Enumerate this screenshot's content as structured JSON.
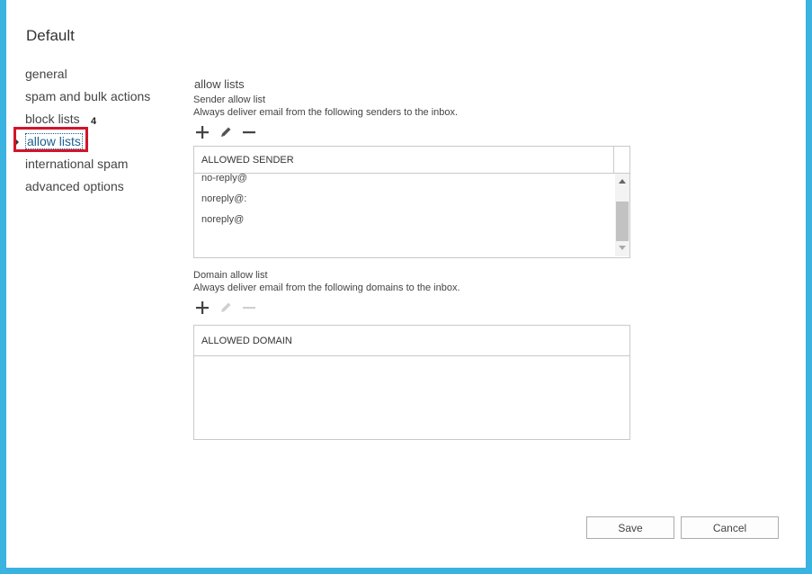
{
  "title": "Default",
  "nav": {
    "items": [
      {
        "label": "general"
      },
      {
        "label": "spam and bulk actions"
      },
      {
        "label": "block lists"
      },
      {
        "label": "allow lists"
      },
      {
        "label": "international spam"
      },
      {
        "label": "advanced options"
      }
    ],
    "selected_index": 3,
    "step_marker": "4"
  },
  "allow_lists": {
    "heading": "allow lists",
    "sender": {
      "heading": "Sender allow list",
      "description": "Always deliver email from the following senders to the inbox.",
      "toolbar": {
        "add_icon": "plus-icon",
        "edit_icon": "pencil-icon",
        "remove_icon": "minus-icon"
      },
      "column_header": "ALLOWED SENDER",
      "rows": [
        "no-reply@",
        "noreply@:",
        "noreply@"
      ]
    },
    "domain": {
      "heading": "Domain allow list",
      "description": "Always deliver email from the following domains to the inbox.",
      "toolbar": {
        "add_icon": "plus-icon",
        "edit_icon": "pencil-icon",
        "remove_icon": "minus-icon"
      },
      "column_header": "ALLOWED DOMAIN",
      "rows": []
    }
  },
  "buttons": {
    "save": "Save",
    "cancel": "Cancel"
  },
  "colors": {
    "frame_border": "#3ab3e0",
    "highlight": "#d2142a",
    "selected_link": "#1c5f8c"
  }
}
